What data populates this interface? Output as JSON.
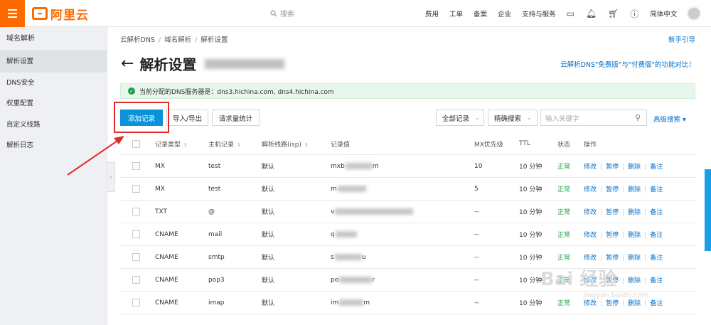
{
  "header": {
    "logo_text": "阿里云",
    "search_placeholder": "搜索",
    "nav": [
      "费用",
      "工单",
      "备案",
      "企业",
      "支持与服务"
    ],
    "language": "简体中文"
  },
  "sidebar": {
    "title": "域名解析",
    "items": [
      {
        "label": "解析设置",
        "active": true
      },
      {
        "label": "DNS安全",
        "active": false
      },
      {
        "label": "权重配置",
        "active": false
      },
      {
        "label": "自定义线路",
        "active": false
      },
      {
        "label": "解析日志",
        "active": false
      }
    ]
  },
  "breadcrumb": [
    "云解析DNS",
    "域名解析",
    "解析设置"
  ],
  "help_link": "新手引导",
  "page_title": "解析设置",
  "compare_link": "云解析DNS\"免费版\"与\"付费版\"的功能对比！",
  "alert": {
    "text": "当前分配的DNS服务器是：dns3.hichina.com, dns4.hichina.com"
  },
  "toolbar": {
    "add_record": "添加记录",
    "import_export": "导入/导出",
    "request_stats": "请求量统计",
    "all_records": "全部记录",
    "exact_search": "精确搜索",
    "keyword_placeholder": "输入关键字",
    "advanced_search": "高级搜索"
  },
  "table": {
    "headers": {
      "type": "记录类型",
      "host": "主机记录",
      "line": "解析线路(isp)",
      "value": "记录值",
      "mx": "MX优先级",
      "ttl": "TTL",
      "status": "状态",
      "ops": "操作"
    },
    "ops": {
      "edit": "修改",
      "pause": "暂停",
      "delete": "删除",
      "note": "备注"
    },
    "rows": [
      {
        "type": "MX",
        "host": "test",
        "line": "默认",
        "value_prefix": "mxb",
        "value_suffix": "m",
        "mx": "10",
        "ttl": "10 分钟",
        "status": "正常"
      },
      {
        "type": "MX",
        "host": "test",
        "line": "默认",
        "value_prefix": "m",
        "value_suffix": "",
        "mx": "5",
        "ttl": "10 分钟",
        "status": "正常"
      },
      {
        "type": "TXT",
        "host": "@",
        "line": "默认",
        "value_prefix": "v",
        "value_suffix": "",
        "mx": "--",
        "ttl": "10 分钟",
        "status": "正常"
      },
      {
        "type": "CNAME",
        "host": "mail",
        "line": "默认",
        "value_prefix": "q",
        "value_suffix": "",
        "mx": "--",
        "ttl": "10 分钟",
        "status": "正常"
      },
      {
        "type": "CNAME",
        "host": "smtp",
        "line": "默认",
        "value_prefix": "s",
        "value_suffix": "u",
        "mx": "--",
        "ttl": "10 分钟",
        "status": "正常"
      },
      {
        "type": "CNAME",
        "host": "pop3",
        "line": "默认",
        "value_prefix": "po",
        "value_suffix": "r",
        "mx": "--",
        "ttl": "10 分钟",
        "status": "正常"
      },
      {
        "type": "CNAME",
        "host": "imap",
        "line": "默认",
        "value_prefix": "im",
        "value_suffix": "m",
        "mx": "--",
        "ttl": "10 分钟",
        "status": "正常"
      }
    ]
  },
  "watermark": "Bai 经验",
  "watermark_sub": "jingyan.baidu.com",
  "colors": {
    "brand": "#ff6a00",
    "primary": "#0a93d8",
    "link": "#0070cc",
    "ok": "#1f9e47",
    "highlight": "#e12a2a"
  }
}
